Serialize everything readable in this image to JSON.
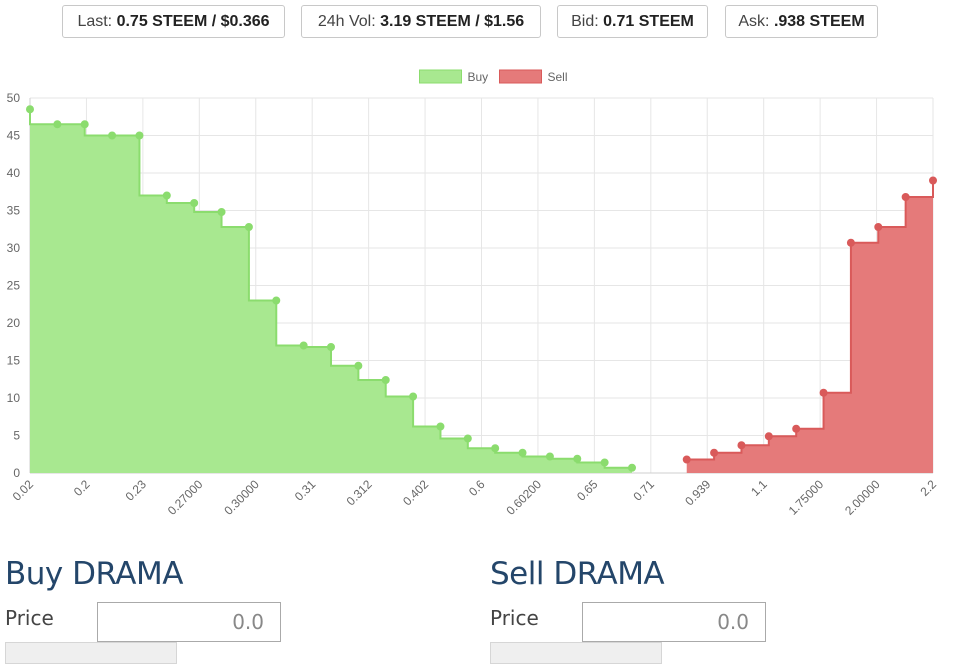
{
  "ticker": {
    "last": {
      "label": "Last:",
      "value": "0.75 STEEM / $0.366"
    },
    "vol": {
      "label": "24h Vol:",
      "value": "3.19 STEEM / $1.56"
    },
    "bid": {
      "label": "Bid:",
      "value": "0.71 STEEM"
    },
    "ask": {
      "label": "Ask:",
      "value": ".938 STEEM"
    }
  },
  "chart_data": {
    "type": "area",
    "stepped": true,
    "ylim": [
      0,
      50
    ],
    "yticks": [
      0,
      5,
      10,
      15,
      20,
      25,
      30,
      35,
      40,
      45,
      50
    ],
    "grid": true,
    "legend_position": "top-center",
    "x_tick_labels": [
      "0.02",
      "0.2",
      "0.23",
      "0.27000",
      "0.30000",
      "0.31",
      "0.312",
      "0.402",
      "0.6",
      "0.60200",
      "0.65",
      "0.71",
      "0.939",
      "1.1",
      "1.75000",
      "2.00000",
      "2.2"
    ],
    "series": [
      {
        "name": "Buy",
        "color": "#a8e890",
        "stroke": "#8bdc6e",
        "values": [
          48.5,
          46.5,
          46.5,
          45.0,
          45.0,
          37.0,
          36.0,
          34.8,
          32.8,
          23.0,
          17.0,
          16.8,
          14.3,
          12.4,
          10.2,
          6.2,
          4.6,
          3.3,
          2.7,
          2.2,
          1.9,
          1.4,
          0.7
        ]
      },
      {
        "name": "Sell",
        "color": "#e57a7a",
        "stroke": "#d95a5a",
        "values": [
          1.8,
          2.7,
          3.7,
          4.9,
          5.9,
          10.7,
          30.7,
          32.8,
          36.8,
          39.0
        ]
      }
    ]
  },
  "buy_form": {
    "title": "Buy DRAMA",
    "price_label": "Price",
    "price_placeholder": "0.0"
  },
  "sell_form": {
    "title": "Sell DRAMA",
    "price_label": "Price",
    "price_placeholder": "0.0"
  }
}
